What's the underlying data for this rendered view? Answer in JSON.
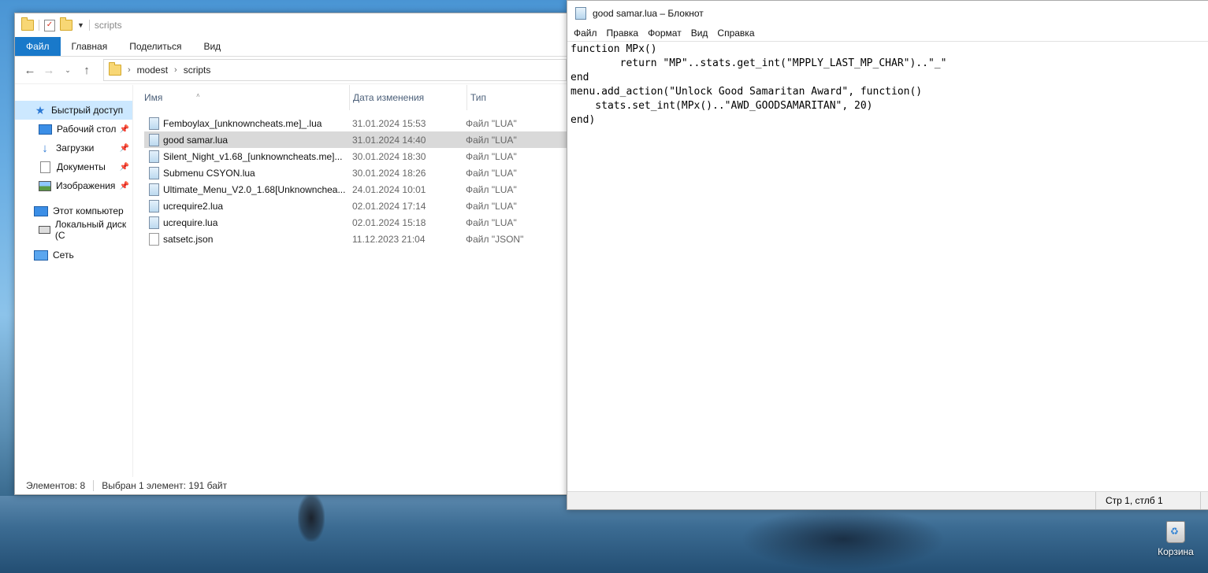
{
  "explorer": {
    "title": "scripts",
    "ribbon_tabs": [
      "Файл",
      "Главная",
      "Поделиться",
      "Вид"
    ],
    "address": {
      "crumbs": [
        "modest",
        "scripts"
      ]
    },
    "nav": {
      "quick_access": "Быстрый доступ",
      "pinned": [
        "Рабочий стол",
        "Загрузки",
        "Документы",
        "Изображения"
      ],
      "this_pc": "Этот компьютер",
      "local_disk": "Локальный диск (C",
      "network": "Сеть"
    },
    "columns": {
      "name": "Имя",
      "date": "Дата изменения",
      "type": "Тип"
    },
    "files": [
      {
        "name": "Femboylax_[unknowncheats.me]_.lua",
        "date": "31.01.2024 15:53",
        "type": "Файл \"LUA\"",
        "icon": "lua-file-icon"
      },
      {
        "name": "good samar.lua",
        "date": "31.01.2024 14:40",
        "type": "Файл \"LUA\"",
        "icon": "lua-file-icon",
        "selected": true
      },
      {
        "name": "Silent_Night_v1.68_[unknowncheats.me]...",
        "date": "30.01.2024 18:30",
        "type": "Файл \"LUA\"",
        "icon": "lua-file-icon"
      },
      {
        "name": "Submenu CSYON.lua",
        "date": "30.01.2024 18:26",
        "type": "Файл \"LUA\"",
        "icon": "lua-file-icon"
      },
      {
        "name": "Ultimate_Menu_V2.0_1.68[Unknownchea...",
        "date": "24.01.2024 10:01",
        "type": "Файл \"LUA\"",
        "icon": "lua-file-icon"
      },
      {
        "name": "ucrequire2.lua",
        "date": "02.01.2024 17:14",
        "type": "Файл \"LUA\"",
        "icon": "lua-file-icon"
      },
      {
        "name": "ucrequire.lua",
        "date": "02.01.2024 15:18",
        "type": "Файл \"LUA\"",
        "icon": "lua-file-icon"
      },
      {
        "name": "satsetc.json",
        "date": "11.12.2023 21:04",
        "type": "Файл \"JSON\"",
        "icon": "json-file-icon"
      }
    ],
    "status": {
      "count": "Элементов: 8",
      "selection": "Выбран 1 элемент: 191 байт"
    }
  },
  "notepad": {
    "title": "good samar.lua – Блокнот",
    "menu": [
      "Файл",
      "Правка",
      "Формат",
      "Вид",
      "Справка"
    ],
    "content": "function MPx()\n        return \"MP\"..stats.get_int(\"MPPLY_LAST_MP_CHAR\")..\"_\"\nend\nmenu.add_action(\"Unlock Good Samaritan Award\", function()\n    stats.set_int(MPx()..\"AWD_GOODSAMARITAN\", 20)\nend)",
    "status_position": "Стр 1, стлб 1"
  },
  "desktop": {
    "recycle_bin": "Корзина"
  }
}
